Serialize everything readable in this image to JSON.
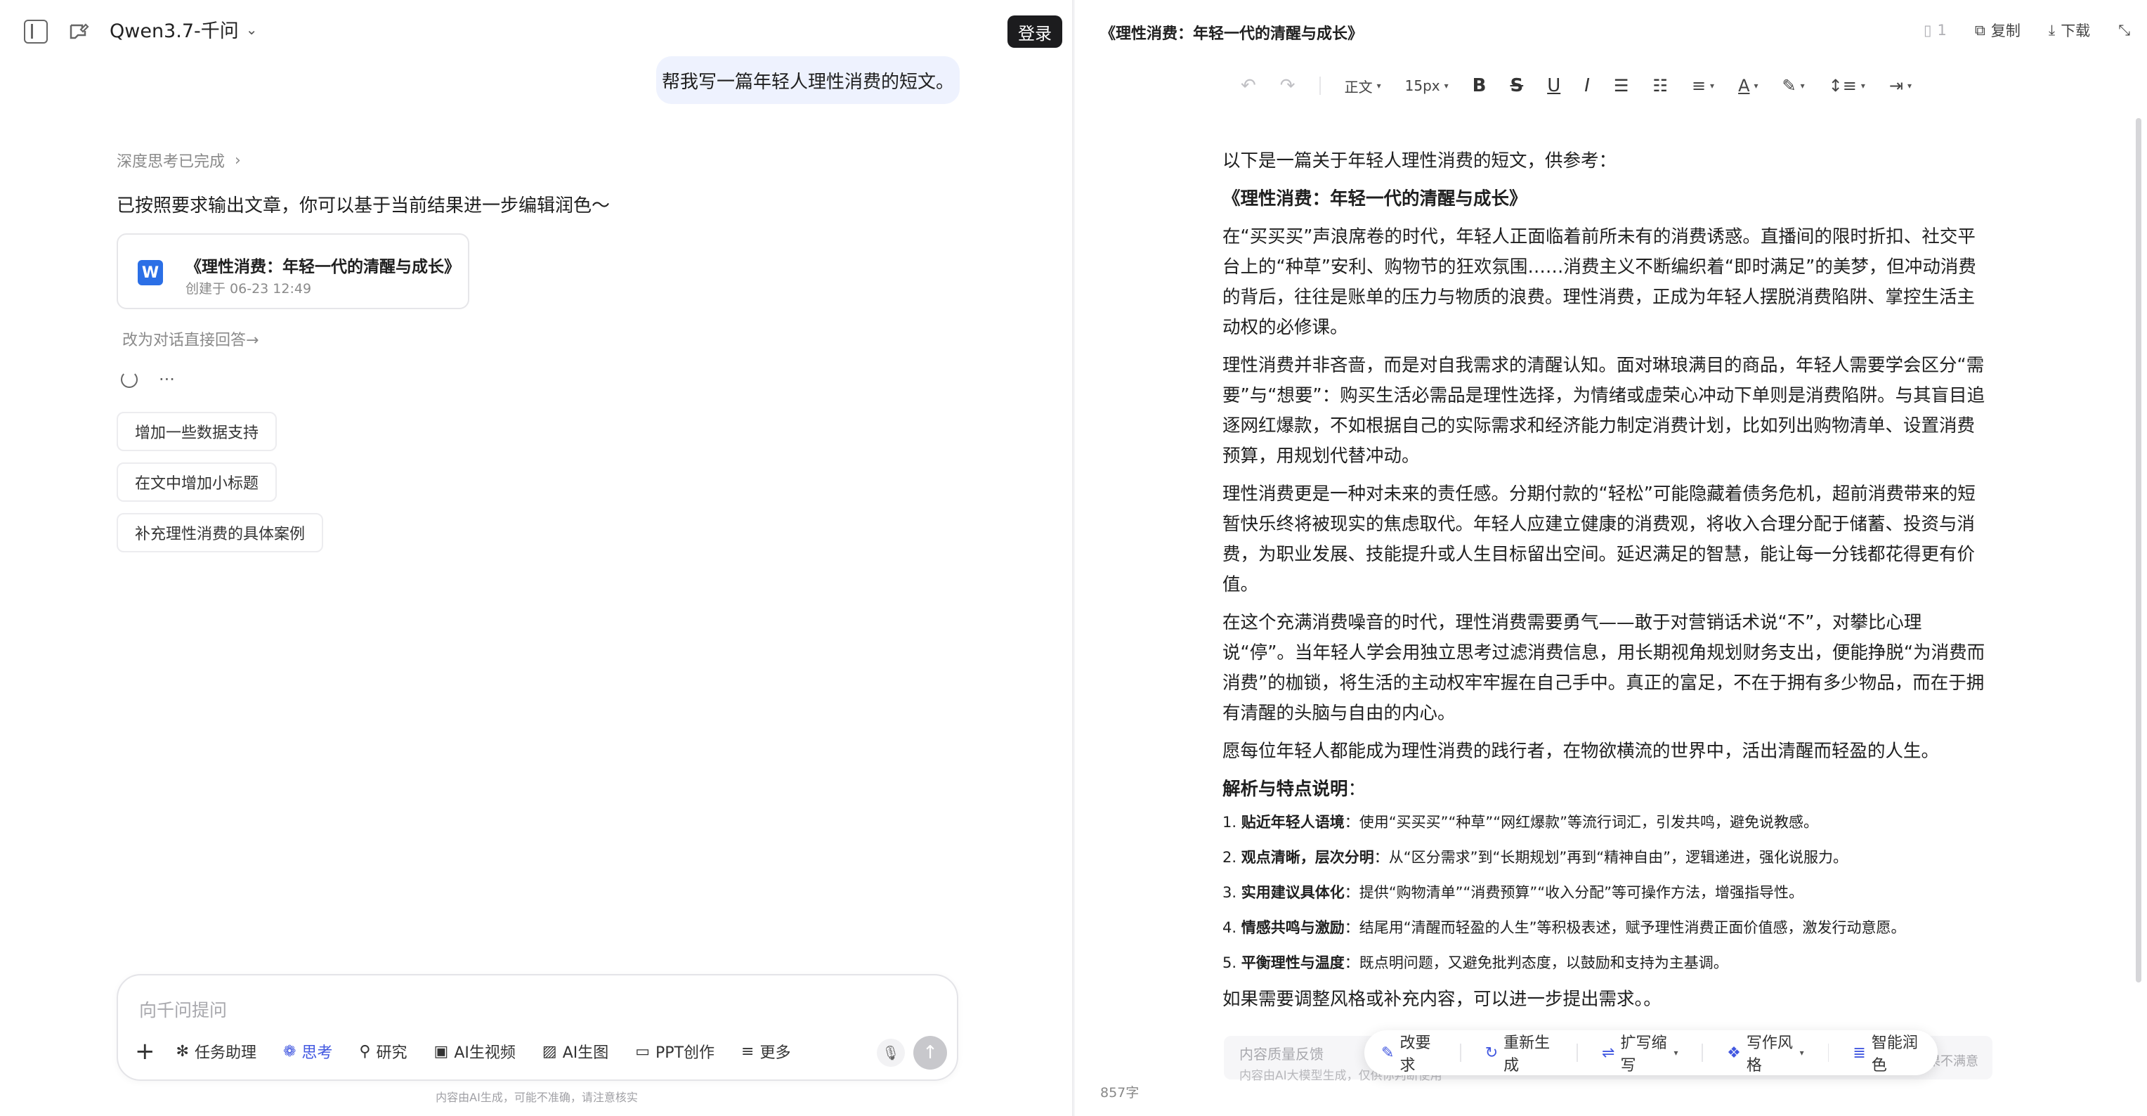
{
  "header": {
    "model_name": "Qwen3.7-千问",
    "login_label": "登录"
  },
  "chat": {
    "user_message": "帮我写一篇年轻人理性消费的短文。",
    "thinking_status": "深度思考已完成",
    "assistant_reply": "已按照要求输出文章，你可以基于当前结果进一步编辑润色～",
    "doc_card": {
      "icon": "W",
      "title": "《理性消费：年轻一代的清醒与成长》",
      "created": "创建于 06-23 12:49"
    },
    "switch_link": "改为对话直接回答→",
    "more_label": "···",
    "suggestions": [
      "增加一些数据支持",
      "在文中增加小标题",
      "补充理性消费的具体案例"
    ]
  },
  "composer": {
    "placeholder": "向千问提问",
    "tools": {
      "task": "任务助理",
      "think": "思考",
      "research": "研究",
      "video": "AI生视频",
      "image": "AI生图",
      "ppt": "PPT创作",
      "more": "更多"
    },
    "disclaimer": "内容由AI生成，可能不准确，请注意核实"
  },
  "document": {
    "title": "《理性消费：年轻一代的清醒与成长》",
    "version": "1",
    "copy_label": "复制",
    "download_label": "下载",
    "toolbar": {
      "style": "正文",
      "size": "15px"
    },
    "intro": "以下是一篇关于年轻人理性消费的短文，供参考：",
    "heading": "《理性消费：年轻一代的清醒与成长》",
    "paragraphs": [
      "在“买买买”声浪席卷的时代，年轻人正面临着前所未有的消费诱惑。直播间的限时折扣、社交平台上的“种草”安利、购物节的狂欢氛围……消费主义不断编织着“即时满足”的美梦，但冲动消费的背后，往往是账单的压力与物质的浪费。理性消费，正成为年轻人摆脱消费陷阱、掌控生活主动权的必修课。",
      "理性消费并非吝啬，而是对自我需求的清醒认知。面对琳琅满目的商品，年轻人需要学会区分“需要”与“想要”：购买生活必需品是理性选择，为情绪或虚荣心冲动下单则是消费陷阱。与其盲目追逐网红爆款，不如根据自己的实际需求和经济能力制定消费计划，比如列出购物清单、设置消费预算，用规划代替冲动。",
      "理性消费更是一种对未来的责任感。分期付款的“轻松”可能隐藏着债务危机，超前消费带来的短暂快乐终将被现实的焦虑取代。年轻人应建立健康的消费观，将收入合理分配于储蓄、投资与消费，为职业发展、技能提升或人生目标留出空间。延迟满足的智慧，能让每一分钱都花得更有价值。",
      "在这个充满消费噪音的时代，理性消费需要勇气——敢于对营销话术说“不”，对攀比心理说“停”。当年轻人学会用独立思考过滤消费信息，用长期视角规划财务支出，便能挣脱“为消费而消费”的枷锁，将生活的主动权牢牢握在自己手中。真正的富足，不在于拥有多少物品，而在于拥有清醒的头脑与自由的内心。",
      "愿每位年轻人都能成为理性消费的践行者，在物欲横流的世界中，活出清醒而轻盈的人生。"
    ],
    "analysis_title": "解析与特点说明",
    "analysis_colon": "：",
    "points": [
      {
        "n": "1. ",
        "k": "贴近年轻人语境",
        "v": "：使用“买买买”“种草”“网红爆款”等流行词汇，引发共鸣，避免说教感。"
      },
      {
        "n": "2. ",
        "k": "观点清晰，层次分明",
        "v": "：从“区分需求”到“长期规划”再到“精神自由”，逻辑递进，强化说服力。"
      },
      {
        "n": "3. ",
        "k": "实用建议具体化",
        "v": "：提供“购物清单”“消费预算”“收入分配”等可操作方法，增强指导性。"
      },
      {
        "n": "4. ",
        "k": "情感共鸣与激励",
        "v": "：结尾用“清醒而轻盈的人生”等积极表述，赋予理性消费正面价值感，激发行动意愿。"
      },
      {
        "n": "5. ",
        "k": "平衡理性与温度",
        "v": "：既点明问题，又避免批判态度，以鼓励和支持为主基调。"
      }
    ],
    "closing": "如果需要调整风格或补充内容，可以进一步提出需求。。",
    "feedback_left": "内容质量反馈",
    "feedback_sub": "内容由AI大模型生成，仅供你判断使用",
    "feedback_right": "效果不满意",
    "floating": {
      "revise": "改要求",
      "regen": "重新生成",
      "expand": "扩写缩写",
      "style": "写作风格",
      "polish": "智能润色"
    },
    "word_count": "857字"
  },
  "colors": {
    "accent": "#4157e0",
    "login_bg": "#1c1c1e",
    "user_bubble": "#eef2fe",
    "word_icon": "#2b6fe6"
  }
}
